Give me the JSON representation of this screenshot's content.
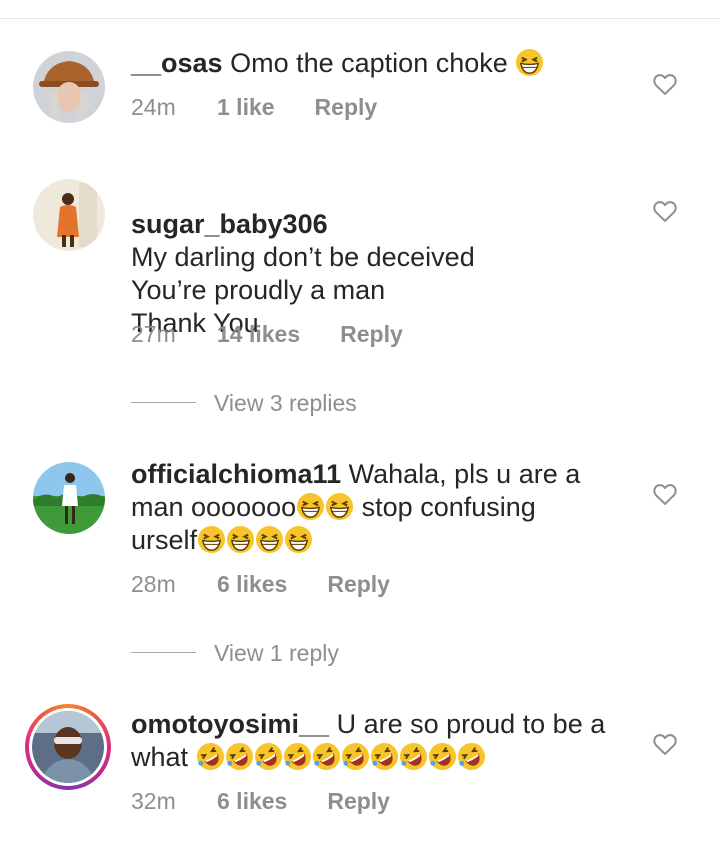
{
  "comments": [
    {
      "username": "__osas",
      "text": "Omo the caption choke",
      "emojis": [
        "grinning-squint"
      ],
      "time": "24m",
      "likes": "1 like",
      "reply": "Reply"
    },
    {
      "username": "sugar_baby306",
      "text": "My darling don’t be deceived\nYou’re proudly a man\nThank You",
      "time": "27m",
      "likes": "14 likes",
      "reply": "Reply",
      "view_replies": "View 3 replies"
    },
    {
      "username": "officialchioma11",
      "text_1": "Wahala, pls u are a man ooooooo",
      "text_2": "stop confusing urself",
      "emojis_1": [
        "grinning-squint",
        "grinning-squint"
      ],
      "emojis_2": [
        "grinning-squint",
        "grinning-squint",
        "grinning-squint",
        "grinning-squint"
      ],
      "time": "28m",
      "likes": "6 likes",
      "reply": "Reply",
      "view_replies": "View 1 reply"
    },
    {
      "username": "omotoyosimi__",
      "text_1": "U are so proud to be a",
      "text_2": "what",
      "emojis": [
        "rofl",
        "rofl",
        "rofl",
        "rofl",
        "rofl",
        "rofl",
        "rofl",
        "rofl",
        "rofl",
        "rofl"
      ],
      "time": "32m",
      "likes": "6 likes",
      "reply": "Reply"
    }
  ],
  "icons": {
    "like": "heart-outline-icon",
    "emoji_laugh": "grinning-squinting-face",
    "emoji_rofl": "rolling-on-floor-laughing-face"
  },
  "colors": {
    "text": "#262626",
    "meta": "#8e8e8e",
    "emoji": "#f7c52b"
  }
}
